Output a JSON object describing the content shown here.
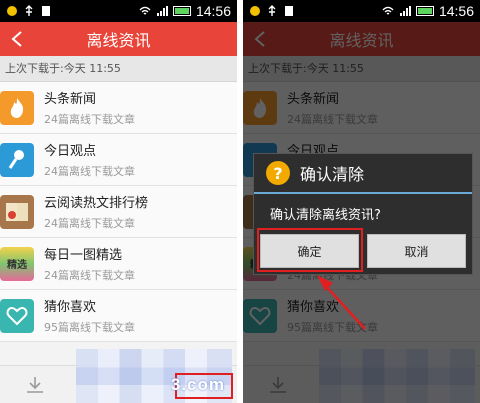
{
  "status": {
    "time": "14:56"
  },
  "app": {
    "title": "离线资讯",
    "last_download": "上次下载于:今天 11:55"
  },
  "items": [
    {
      "name": "头条新闻",
      "count": "24篇离线下载文章",
      "icon": "flame-icon",
      "color": "#f39a2a"
    },
    {
      "name": "今日观点",
      "count": "24篇离线下载文章",
      "icon": "microphone-icon",
      "color": "#2d9ad8"
    },
    {
      "name": "云阅读热文排行榜",
      "count": "24篇离线下载文章",
      "icon": "book-icon",
      "color": "#a7764a"
    },
    {
      "name": "每日一图精选",
      "count": "24篇离线下载文章",
      "icon": "daily-picture-icon",
      "color": "#7fc56f",
      "icon_label": "精选"
    },
    {
      "name": "猜你喜欢",
      "count": "95篇离线下载文章",
      "icon": "heart-icon",
      "color": "#3ab6b0"
    }
  ],
  "dialog": {
    "title": "确认清除",
    "message": "确认清除离线资讯?",
    "confirm_label": "确定",
    "cancel_label": "取消"
  },
  "watermark": "3.com",
  "colors": {
    "titlebar": "#e8443a",
    "highlight": "#e02020"
  }
}
